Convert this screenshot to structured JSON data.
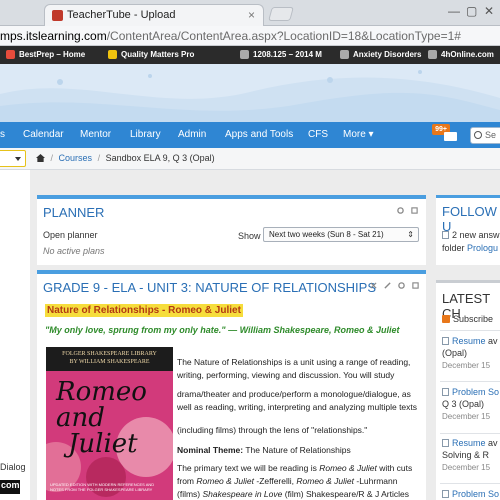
{
  "browser": {
    "tab_title": "TeacherTube - Upload",
    "url_domain": "mps.itslearning.com",
    "url_path": "/ContentArea/ContentArea.aspx?LocationID=18&LocationType=1#",
    "bookmarks": [
      {
        "label": "BestPrep – Home",
        "color": "#e74c3c"
      },
      {
        "label": "Quality Matters Pro",
        "color": "#f1c40f"
      },
      {
        "label": "1208.125 – 2014 M",
        "color": "#aaaaaa"
      },
      {
        "label": "Anxiety Disorders",
        "color": "#aaaaaa"
      },
      {
        "label": "4hOnline.com",
        "color": "#aaaaaa"
      }
    ]
  },
  "nav": {
    "items": [
      "s",
      "Calendar",
      "Mentor",
      "Library",
      "Admin",
      "Apps and Tools",
      "CFS",
      "More ▾"
    ],
    "badge": "99+",
    "search_placeholder": "Se"
  },
  "breadcrumb": {
    "courses": "Courses",
    "current": "Sandbox ELA 9, Q 3 (Opal)"
  },
  "planner": {
    "title": "PLANNER",
    "open": "Open planner",
    "empty": "No active plans",
    "show_label": "Show",
    "range": "Next two weeks (Sun 8 - Sat 21)"
  },
  "unit": {
    "title": "GRADE 9 - ELA - UNIT 3: NATURE OF RELATIONSHIPS",
    "banner": "Nature of Relationships - Romeo & Juliet",
    "quote": "\"My only love, sprung from my only hate.\" — William Shakespeare, Romeo & Juliet",
    "book": {
      "series": "FOLGER SHAKESPEARE LIBRARY",
      "author": "BY WILLIAM SHAKESPEARE",
      "title_line1": "Romeo and",
      "title_line2": "Juliet",
      "fine_print": "UPDATED EDITION WITH MODERN REFERENCES AND NOTES FROM THE FOLGER SHAKESPEARE LIBRARY"
    },
    "p1": "The Nature of Relationships is a unit using a range of reading, writing, performing, viewing and discussion. You will study",
    "p2": "drama/theater and produce/perform a monologue/dialogue, as well as reading, writing, interpreting and analyzing multiple texts",
    "p3": "(including films) through the lens of \"relationships.\"",
    "theme_label": "Nominal Theme:",
    "theme_value": " The Nature of Relationships",
    "p5a": "The primary text we will be reading is ",
    "p5b": "Romeo & Juliet",
    "p5c": " with cuts from ",
    "p5d": "Romeo & Juliet",
    "p5e": " -Zefferelli, ",
    "p5f": "Romeo & Juliet",
    "p5g": " -Luhrmann",
    "p6a": "(films) ",
    "p6b": "Shakespeare in Love",
    "p6c": " (film) Shakespeare/R & J Articles"
  },
  "follow": {
    "title": "FOLLOW U",
    "line1": "2 new answ",
    "line2a": "folder ",
    "line2b": "Prologu"
  },
  "latest": {
    "title": "LATEST CH",
    "subscribe": "Subscribe",
    "entries": [
      {
        "title": "Resume",
        "rest": " av",
        "extra": "(Opal)",
        "date": "December 15"
      },
      {
        "title": "Problem So",
        "rest": "",
        "extra": "Q 3 (Opal)",
        "date": "December 15"
      },
      {
        "title": "Resume",
        "rest": " av",
        "extra": "Solving & R",
        "date": "December 15"
      },
      {
        "title": "Problem So",
        "rest": "",
        "extra": "",
        "date": ""
      }
    ]
  },
  "left": {
    "dialog": "Dialog",
    "com": "com"
  }
}
